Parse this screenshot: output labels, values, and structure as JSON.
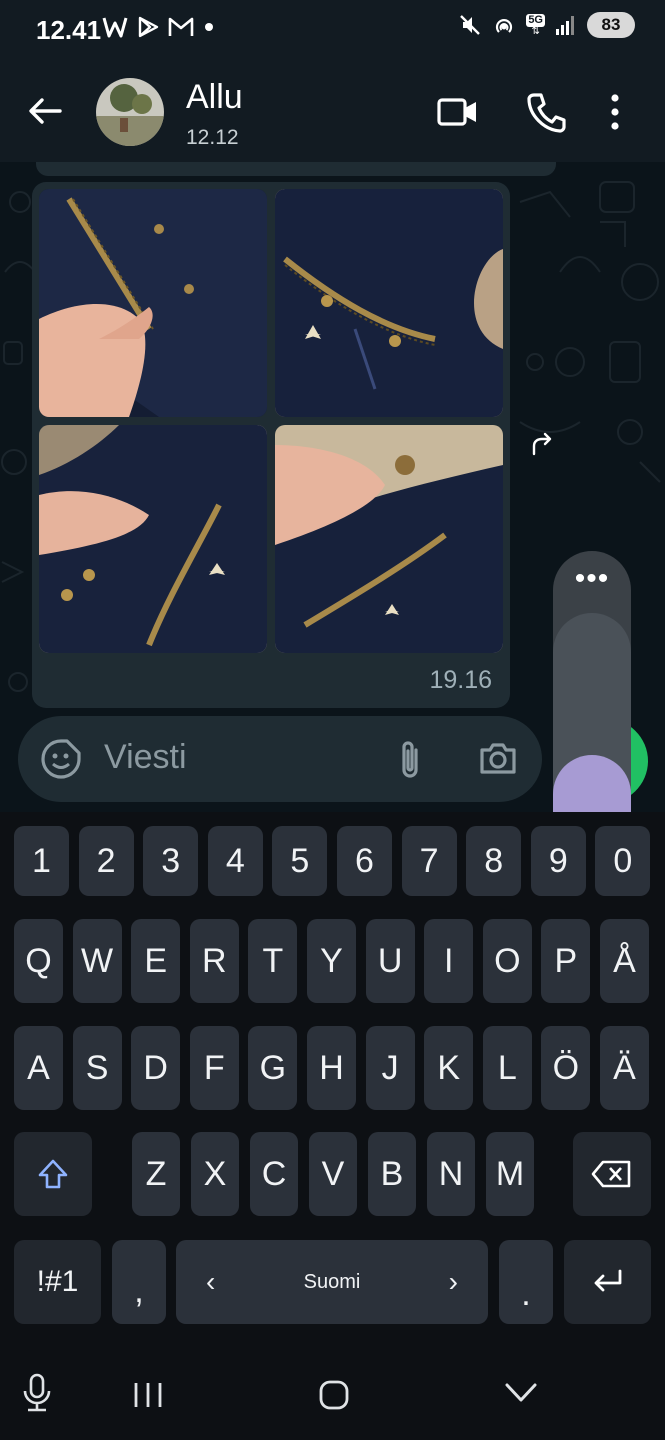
{
  "status_bar": {
    "time": "12.41",
    "network": "5G",
    "battery": "83",
    "icons": [
      "w-app-icon",
      "play-icon",
      "gmail-icon",
      "dot-icon",
      "mute-icon",
      "hotspot-icon",
      "signal-icon"
    ]
  },
  "header": {
    "contact_name": "Allu",
    "last_seen": "12.12",
    "icons": [
      "back-arrow-icon",
      "video-call-icon",
      "phone-icon",
      "more-vert-icon"
    ]
  },
  "message": {
    "photo_count": 4,
    "time": "19.16"
  },
  "composer": {
    "placeholder": "Viesti"
  },
  "volume_panel": {
    "more_label": "•••",
    "level": 0.55
  },
  "keyboard": {
    "rows": [
      [
        "1",
        "2",
        "3",
        "4",
        "5",
        "6",
        "7",
        "8",
        "9",
        "0"
      ],
      [
        "Q",
        "W",
        "E",
        "R",
        "T",
        "Y",
        "U",
        "I",
        "O",
        "P",
        "Å"
      ],
      [
        "A",
        "S",
        "D",
        "F",
        "G",
        "H",
        "J",
        "K",
        "L",
        "Ö",
        "Ä"
      ],
      [
        "Z",
        "X",
        "C",
        "V",
        "B",
        "N",
        "M"
      ]
    ],
    "symbols_label": "!#1",
    "comma_label": ",",
    "period_label": ".",
    "language_label": "Suomi",
    "lang_prev": "‹",
    "lang_next": "›"
  },
  "colors": {
    "accent_green": "#21c063",
    "volume_fill": "#a79bd3",
    "bubble": "#1f2c33"
  }
}
